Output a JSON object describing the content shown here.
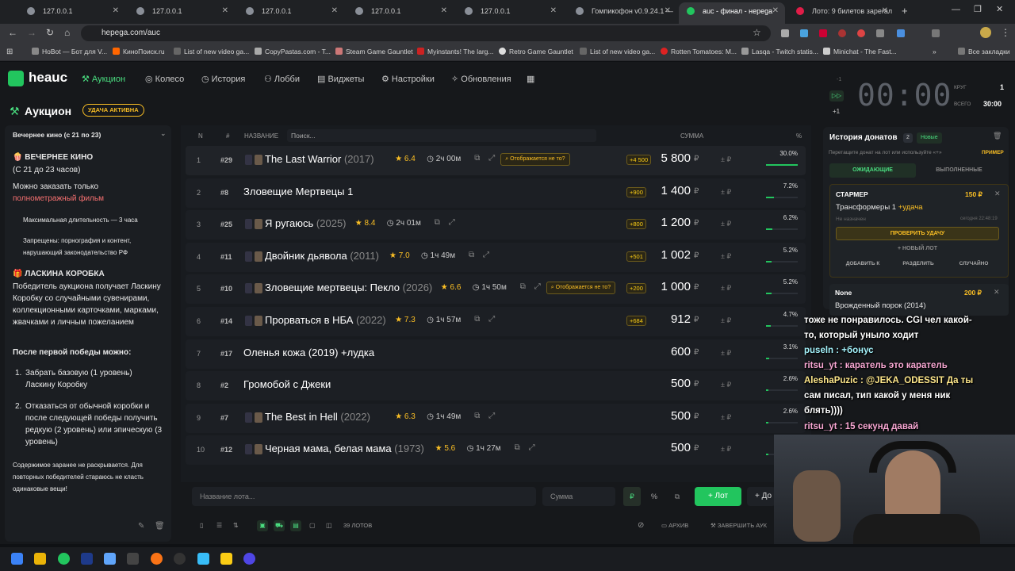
{
  "browser": {
    "tabs": [
      {
        "title": "127.0.0.1"
      },
      {
        "title": "127.0.0.1"
      },
      {
        "title": "127.0.0.1"
      },
      {
        "title": "127.0.0.1"
      },
      {
        "title": "127.0.0.1"
      },
      {
        "title": "Гомпикофон v0.9.24.1 —"
      },
      {
        "title": "auc - финал - неpega"
      },
      {
        "title": "Лото: 9 билетов зарегал"
      }
    ],
    "url": "hepega.com/auc",
    "bookmarks": [
      "HoBot — Бот для V...",
      "КиноПоиск.ru",
      "List of new video ga...",
      "CopyPastas.com - T...",
      "Steam Game Gauntlet",
      "Myinstants! The larg...",
      "Retro Game Gauntlet",
      "List of new video ga...",
      "Rotten Tomatoes: M...",
      "Lasqa - Twitch statis...",
      "Minichat - The Fast..."
    ],
    "all_bookmarks": "Все закладки"
  },
  "nav": {
    "logo": "heauc",
    "items": [
      "Аукцион",
      "Колесо",
      "История",
      "Лобби",
      "Виджеты",
      "Настройки",
      "Обновления"
    ]
  },
  "page": {
    "title": "Аукцион",
    "luck_badge": "УДАЧА АКТИВНА"
  },
  "left": {
    "dropdown": "Вечернее кино (с 21 по 23)",
    "h1": "🍿 ВЕЧЕРНЕЕ КИНО",
    "h1b": "(С 21 до 23 часов)",
    "p1": "Можно заказать только",
    "p1red": "полнометражный фильм",
    "b1": "Максимальная длительность — 3 часа",
    "b2": "Запрещены: порнография и контент, нарушающий законодательство РФ",
    "h2": "🎁 ЛАСКИНА КОРОБКА",
    "p2": "Победитель аукциона получает Ласкину Коробку со случайными сувенирами, коллекционными карточками, марками, жвачками и личным пожеланием",
    "p3": "После первой победы можно:",
    "o1": "Забрать базовую (1 уровень) Ласкину Коробку",
    "o2": "Отказаться от обычной коробки и после следующей победы получить редкую (2 уровень) или эпическую (3 уровень)",
    "foot": "Содержимое заранее не раскрывается. Для повторных победителей стараюсь не класть одинаковые вещи!"
  },
  "table": {
    "headers": {
      "n": "N",
      "hash": "#",
      "name": "НАЗВАНИЕ",
      "search": "Поиск...",
      "sum": "СУММА",
      "pct": "%"
    },
    "rows": [
      {
        "n": "1",
        "id": "#29",
        "title": "The Last Warrior",
        "year": "(2017)",
        "rating": "★ 6.4",
        "dur": "2ч 00м",
        "badge": "Отображается не то?",
        "plus": "+4 500",
        "sum": "5 800",
        "pct": "30.0%",
        "frac": 0.3
      },
      {
        "n": "2",
        "id": "#8",
        "title": "Зловещие Мертвецы 1",
        "year": "",
        "rating": "",
        "dur": "",
        "badge": "",
        "plus": "+900",
        "sum": "1 400",
        "pct": "7.2%",
        "frac": 0.072
      },
      {
        "n": "3",
        "id": "#25",
        "title": "Я ругаюсь",
        "year": "(2025)",
        "rating": "★ 8.4",
        "dur": "2ч 01м",
        "badge": "",
        "plus": "+800",
        "sum": "1 200",
        "pct": "6.2%",
        "frac": 0.062
      },
      {
        "n": "4",
        "id": "#11",
        "title": "Двойник дьявола",
        "year": "(2011)",
        "rating": "★ 7.0",
        "dur": "1ч 49м",
        "badge": "",
        "plus": "+501",
        "sum": "1 002",
        "pct": "5.2%",
        "frac": 0.052
      },
      {
        "n": "5",
        "id": "#10",
        "title": "Зловещие мертвецы: Пекло",
        "year": "(2026)",
        "rating": "★ 6.6",
        "dur": "1ч 50м",
        "badge": "Отображается не то?",
        "plus": "+200",
        "sum": "1 000",
        "pct": "5.2%",
        "frac": 0.052
      },
      {
        "n": "6",
        "id": "#14",
        "title": "Прорваться в НБА",
        "year": "(2022)",
        "rating": "★ 7.3",
        "dur": "1ч 57м",
        "badge": "",
        "plus": "+684",
        "sum": "912",
        "pct": "4.7%",
        "frac": 0.047
      },
      {
        "n": "7",
        "id": "#17",
        "title": "Оленья кожа (2019) +лудка",
        "year": "",
        "rating": "",
        "dur": "",
        "badge": "",
        "plus": "",
        "sum": "600",
        "pct": "3.1%",
        "frac": 0.031
      },
      {
        "n": "8",
        "id": "#2",
        "title": "Громобой с Джеки",
        "year": "",
        "rating": "",
        "dur": "",
        "badge": "",
        "plus": "",
        "sum": "500",
        "pct": "2.6%",
        "frac": 0.026
      },
      {
        "n": "9",
        "id": "#7",
        "title": "The Best in Hell",
        "year": "(2022)",
        "rating": "★ 6.3",
        "dur": "1ч 49м",
        "badge": "",
        "plus": "",
        "sum": "500",
        "pct": "2.6%",
        "frac": 0.026
      },
      {
        "n": "10",
        "id": "#12",
        "title": "Черная мама, белая мама",
        "year": "(1973)",
        "rating": "★ 5.6",
        "dur": "1ч 27м",
        "badge": "",
        "plus": "",
        "sum": "500",
        "pct": "",
        "frac": 0.026
      }
    ],
    "currency": "₽",
    "pm": "± ₽"
  },
  "bottom": {
    "lot_placeholder": "Название лота...",
    "sum_placeholder": "Сумма",
    "rub": "₽",
    "pct": "%",
    "add": "+ Лот",
    "add2": "+ До",
    "count": "39 ЛОТОВ",
    "archive": "АРХИВ",
    "finish": "ЗАВЕРШИТЬ АУК"
  },
  "timer": {
    "value": "00:00",
    "round_label": "КРУГ",
    "round": "1",
    "total_label": "ВСЕГО",
    "total": "30:00",
    "plus": "+1",
    "minus": "-1"
  },
  "history": {
    "title": "История донатов",
    "count": "2",
    "new": "Новые",
    "hint": "Перетащите донат на лот или используйте «+»",
    "example": "ПРИМЕР",
    "tab1": "ОЖИДАЮЩИЕ",
    "tab2": "ВЫПОЛНЕННЫЕ",
    "d1_user": "СТАРМЕР",
    "d1_amount": "150 ₽",
    "d1_text": "Трансформеры 1",
    "d1_luck": "+удача",
    "d1_assign": "Не назначен",
    "d1_time": "сегодня 22:48:19",
    "d1_check": "ПРОВЕРИТЬ УДАЧУ",
    "d1_newlot": "+ НОВЫЙ ЛОТ",
    "d1_add": "ДОБАВИТЬ К",
    "d1_split": "РАЗДЕЛИТЬ",
    "d1_rand": "СЛУЧАЙНО",
    "d2_user": "None",
    "d2_amount": "200 ₽",
    "d2_text": "Врожденный порок (2014)"
  },
  "chat": [
    "тоже не понравилось. CGI чел какой-",
    "то, который уныло ходит",
    "puseln : +бонус",
    "ritsu_yt : каратель это каратель",
    "AleshaPuzic : @JEKA_ODESSIT Да ты",
    "сам писал, тип какой у меня ник",
    "блять))))",
    "ritsu_yt : 15 секунд давай"
  ],
  "colors": {
    "accent": "#22c55e",
    "gold": "#fbbf24",
    "bg": "#16181b"
  }
}
